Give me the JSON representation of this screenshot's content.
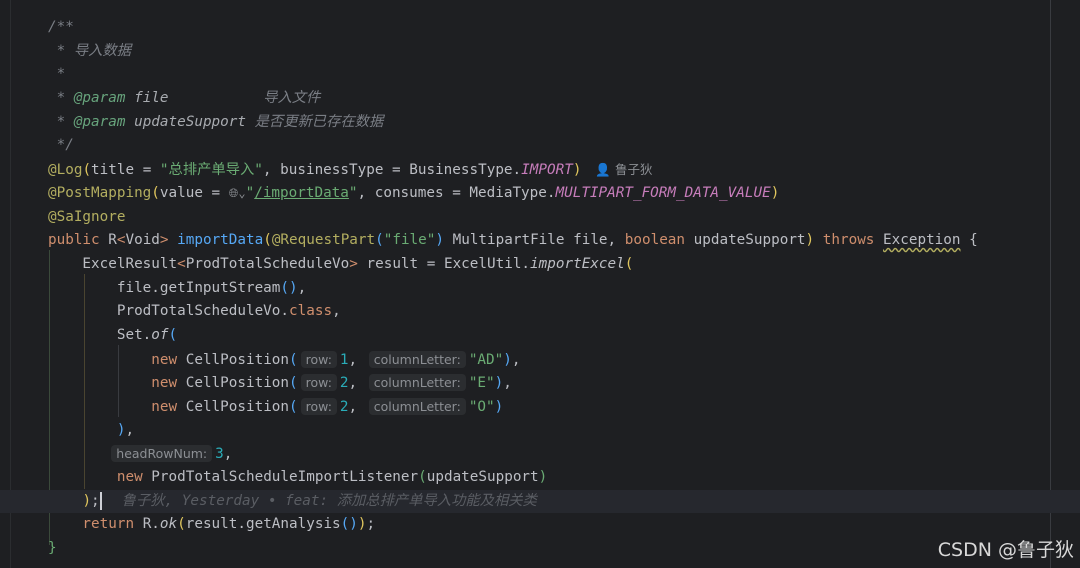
{
  "colors": {
    "background": "#1e1f22",
    "keyword": "#cf8e6d",
    "annotation": "#b3ae60",
    "string": "#6aab73",
    "comment": "#7a7e85",
    "number": "#2aacb8",
    "method": "#56a8f5",
    "static_field": "#c77dbb"
  },
  "current_line": 21,
  "lines": [
    [
      [
        "c",
        "/**"
      ]
    ],
    [
      [
        "c",
        " * 导入数据"
      ]
    ],
    [
      [
        "c",
        " *"
      ]
    ],
    [
      [
        "c",
        " * "
      ],
      [
        "ct",
        "@param"
      ],
      [
        "ci",
        " file"
      ],
      [
        "c",
        "           导入文件"
      ]
    ],
    [
      [
        "c",
        " * "
      ],
      [
        "ct",
        "@param"
      ],
      [
        "ci",
        " updateSupport"
      ],
      [
        "c",
        " 是否更新已存在数据"
      ]
    ],
    [
      [
        "c",
        " */"
      ]
    ],
    [
      [
        "a",
        "@Log"
      ],
      [
        "py",
        "("
      ],
      [
        "t",
        "title = "
      ],
      [
        "s",
        "\"总排产单导入\""
      ],
      [
        "t",
        ", businessType = BusinessType."
      ],
      [
        "f",
        "IMPORT"
      ],
      [
        "py",
        ")"
      ],
      [
        "au",
        "👤 鲁子狄"
      ]
    ],
    [
      [
        "a",
        "@PostMapping"
      ],
      [
        "py",
        "("
      ],
      [
        "t",
        "value = "
      ],
      [
        "g",
        "🌐︎⌄"
      ],
      [
        "s",
        "\""
      ],
      [
        "u",
        "/importData"
      ],
      [
        "s",
        "\""
      ],
      [
        "t",
        ", consumes = MediaType."
      ],
      [
        "f",
        "MULTIPART_FORM_DATA_VALUE"
      ],
      [
        "py",
        ")"
      ]
    ],
    [
      [
        "a",
        "@SaIgnore"
      ]
    ],
    [
      [
        "k",
        "public "
      ],
      [
        "t",
        "R"
      ],
      [
        "k",
        "<"
      ],
      [
        "t",
        "Void"
      ],
      [
        "k",
        "> "
      ],
      [
        "m",
        "importData"
      ],
      [
        "py",
        "("
      ],
      [
        "a",
        "@RequestPart"
      ],
      [
        "pb",
        "("
      ],
      [
        "s",
        "\"file\""
      ],
      [
        "pb",
        ")"
      ],
      [
        "t",
        " MultipartFile file, "
      ],
      [
        "k",
        "boolean "
      ],
      [
        "t",
        "updateSupport"
      ],
      [
        "py",
        ")"
      ],
      [
        "k",
        " throws "
      ],
      [
        "y",
        "Exception"
      ],
      [
        "t",
        " {"
      ]
    ],
    [
      [
        "t",
        "    ExcelResult"
      ],
      [
        "k",
        "<"
      ],
      [
        "t",
        "ProdTotalScheduleVo"
      ],
      [
        "k",
        "> "
      ],
      [
        "t",
        "result = ExcelUtil."
      ],
      [
        "i",
        "importExcel"
      ],
      [
        "py",
        "("
      ]
    ],
    [
      [
        "t",
        "        file.getInputStream"
      ],
      [
        "pb",
        "()"
      ],
      [
        "t",
        ","
      ]
    ],
    [
      [
        "t",
        "        ProdTotalScheduleVo."
      ],
      [
        "k",
        "class"
      ],
      [
        "t",
        ","
      ]
    ],
    [
      [
        "t",
        "        Set."
      ],
      [
        "i",
        "of"
      ],
      [
        "pb",
        "("
      ]
    ],
    [
      [
        "k",
        "            new "
      ],
      [
        "t",
        "CellPosition"
      ],
      [
        "pb",
        "("
      ],
      [
        "h",
        "row:"
      ],
      [
        "n",
        "1"
      ],
      [
        "t",
        ", "
      ],
      [
        "h",
        "columnLetter:"
      ],
      [
        "s",
        "\"AD\""
      ],
      [
        "pb",
        ")"
      ],
      [
        "t",
        ","
      ]
    ],
    [
      [
        "k",
        "            new "
      ],
      [
        "t",
        "CellPosition"
      ],
      [
        "pb",
        "("
      ],
      [
        "h",
        "row:"
      ],
      [
        "n",
        "2"
      ],
      [
        "t",
        ", "
      ],
      [
        "h",
        "columnLetter:"
      ],
      [
        "s",
        "\"E\""
      ],
      [
        "pb",
        ")"
      ],
      [
        "t",
        ","
      ]
    ],
    [
      [
        "k",
        "            new "
      ],
      [
        "t",
        "CellPosition"
      ],
      [
        "pb",
        "("
      ],
      [
        "h",
        "row:"
      ],
      [
        "n",
        "2"
      ],
      [
        "t",
        ", "
      ],
      [
        "h",
        "columnLetter:"
      ],
      [
        "s",
        "\"O\""
      ],
      [
        "pb",
        ")"
      ]
    ],
    [
      [
        "t",
        "        "
      ],
      [
        "pb",
        ")"
      ],
      [
        "t",
        ","
      ]
    ],
    [
      [
        "t",
        "       "
      ],
      [
        "h",
        "headRowNum:"
      ],
      [
        "n",
        "3"
      ],
      [
        "t",
        ","
      ]
    ],
    [
      [
        "k",
        "        new "
      ],
      [
        "t",
        "ProdTotalScheduleImportListener"
      ],
      [
        "pg",
        "("
      ],
      [
        "t",
        "updateSupport"
      ],
      [
        "pg",
        ")"
      ]
    ],
    [
      [
        "t",
        "    "
      ],
      [
        "py",
        ")"
      ],
      [
        "t",
        ";"
      ],
      [
        "caret",
        ""
      ],
      [
        "bl",
        "鲁子狄, Yesterday • feat: 添加总排产单导入功能及相关类"
      ]
    ],
    [
      [
        "k",
        "    return "
      ],
      [
        "t",
        "R."
      ],
      [
        "i",
        "ok"
      ],
      [
        "py",
        "("
      ],
      [
        "t",
        "result.getAnalysis"
      ],
      [
        "pb",
        "()"
      ],
      [
        "py",
        ")"
      ],
      [
        "t",
        ";"
      ]
    ],
    [
      [
        "pg",
        "}"
      ]
    ]
  ],
  "watermark": "CSDN @鲁子狄"
}
